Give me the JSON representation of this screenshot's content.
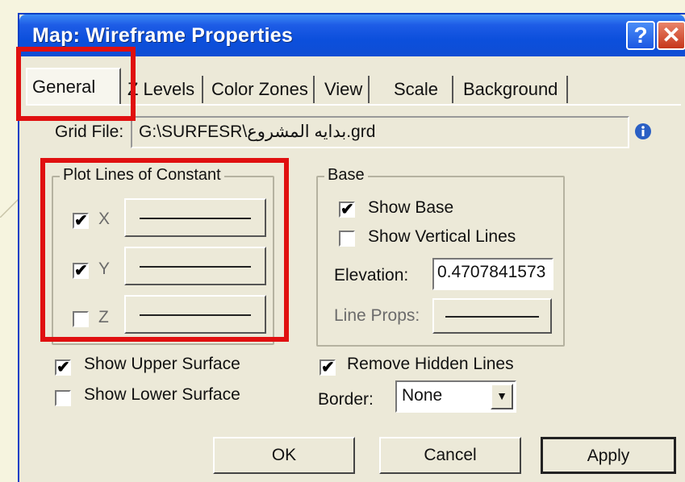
{
  "window": {
    "title": "Map: Wireframe Properties",
    "help_glyph": "?",
    "close_glyph": "✕"
  },
  "tabs": [
    {
      "label": "General"
    },
    {
      "label": "Z Levels"
    },
    {
      "label": "Color Zones"
    },
    {
      "label": "View"
    },
    {
      "label": "Scale"
    },
    {
      "label": "Background"
    }
  ],
  "grid_file": {
    "label": "Grid File:",
    "value": "G:\\SURFESR\\بدايه المشروع.grd"
  },
  "plot_lines": {
    "title": "Plot Lines of Constant",
    "items": [
      {
        "label": "X",
        "checked": true
      },
      {
        "label": "Y",
        "checked": true
      },
      {
        "label": "Z",
        "checked": false
      }
    ]
  },
  "base": {
    "title": "Base",
    "show_base": {
      "label": "Show Base",
      "checked": true
    },
    "show_vertical": {
      "label": "Show Vertical Lines",
      "checked": false
    },
    "elevation_label": "Elevation:",
    "elevation_value": "0.4707841573",
    "line_props_label": "Line Props:"
  },
  "show_upper": {
    "label": "Show Upper Surface",
    "checked": true
  },
  "show_lower": {
    "label": "Show Lower Surface",
    "checked": false
  },
  "remove_hidden": {
    "label": "Remove Hidden Lines",
    "checked": true
  },
  "border": {
    "label": "Border:",
    "value": "None"
  },
  "buttons": {
    "ok": "OK",
    "cancel": "Cancel",
    "apply": "Apply"
  },
  "check_glyph": "✔",
  "colors": {
    "titlebar": "#0c4fdc",
    "highlight": "#e01010",
    "dialog_bg": "#ece9d8"
  }
}
